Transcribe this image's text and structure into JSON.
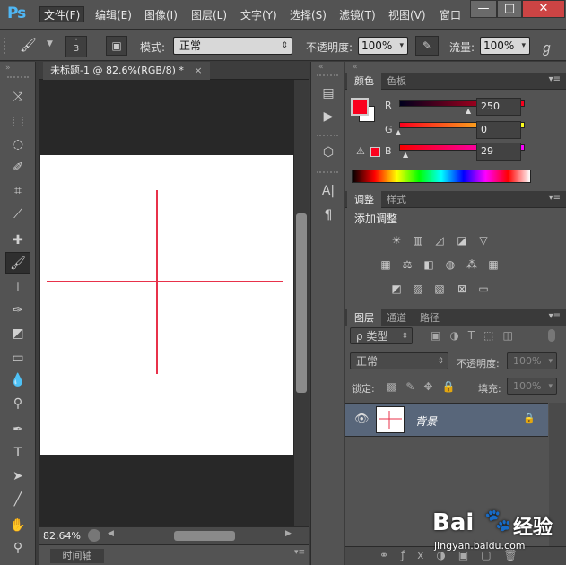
{
  "app": {
    "logo": "Ps"
  },
  "menu": [
    "文件(F)",
    "编辑(E)",
    "图像(I)",
    "图层(L)",
    "文字(Y)",
    "选择(S)",
    "滤镜(T)",
    "视图(V)",
    "窗口"
  ],
  "window_buttons": {
    "minimize": "—",
    "maximize": "□",
    "close": "✕"
  },
  "options": {
    "brush_size": "3",
    "mode_label": "模式:",
    "mode_value": "正常",
    "opacity_label": "不透明度:",
    "opacity_value": "100%",
    "flow_label": "流量:",
    "flow_value": "100%"
  },
  "document": {
    "tab_title": "未标题-1 @ 82.6%(RGB/8) *",
    "tab_close": "×",
    "zoom": "82.64%",
    "timeline_label": "时间轴"
  },
  "color_panel": {
    "tabs": [
      "颜色",
      "色板"
    ],
    "r_label": "R",
    "g_label": "G",
    "b_label": "B",
    "r": "250",
    "g": "0",
    "b": "29",
    "foreground": "#fa001d",
    "background": "#ffffff"
  },
  "adjust_panel": {
    "tabs": [
      "调整",
      "样式"
    ],
    "title": "添加调整"
  },
  "layers_panel": {
    "tabs": [
      "图层",
      "通道",
      "路径"
    ],
    "filter_label": "ρ 类型",
    "blend_value": "正常",
    "opacity_label": "不透明度:",
    "opacity_value": "100%",
    "lock_label": "锁定:",
    "fill_label": "填充:",
    "fill_value": "100%",
    "layers": [
      {
        "name": "背景"
      }
    ]
  },
  "watermark": {
    "brand": "Bai",
    "brand2": "经验",
    "url": "jingyan.baidu.com"
  },
  "colors": {
    "accent": "#e8314a",
    "selected_layer": "#58667a"
  }
}
